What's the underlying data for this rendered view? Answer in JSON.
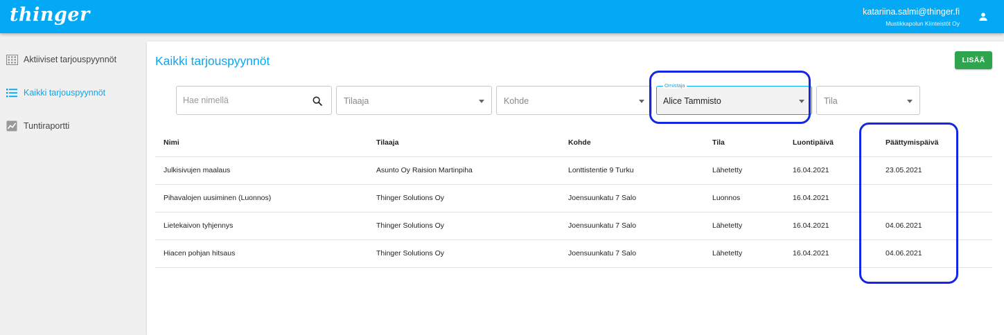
{
  "header": {
    "logo_text": "thinger",
    "user_email": "katariina.salmi@thinger.fi",
    "user_company": "Mustikkapolun Kiinteistöt Oy",
    "accent_color": "#03a9f4"
  },
  "sidebar": {
    "items": [
      {
        "label": "Aktiiviset tarjouspyynnöt",
        "icon": "building-icon",
        "active": false
      },
      {
        "label": "Kaikki tarjouspyynnöt",
        "icon": "list-icon",
        "active": true
      },
      {
        "label": "Tuntiraportti",
        "icon": "chart-icon",
        "active": false
      }
    ]
  },
  "main": {
    "title": "Kaikki tarjouspyynnöt",
    "add_button": "LISÄÄ",
    "add_button_color": "#2ea44f",
    "filters": {
      "search_placeholder": "Hae nimellä",
      "tilaaja_placeholder": "Tilaaja",
      "kohde_placeholder": "Kohde",
      "omistaja_label": "Omistaja",
      "omistaja_value": "Alice Tammisto",
      "tila_placeholder": "Tila"
    },
    "table": {
      "headers": {
        "nimi": "Nimi",
        "tilaaja": "Tilaaja",
        "kohde": "Kohde",
        "tila": "Tila",
        "luontipaiva": "Luontipäivä",
        "paattymispaiva": "Päättymispäivä"
      },
      "rows": [
        {
          "nimi": "Julkisivujen maalaus",
          "tilaaja": "Asunto Oy Raision Martinpiha",
          "kohde": "Lonttistentie 9 Turku",
          "tila": "Lähetetty",
          "luontipaiva": "16.04.2021",
          "paattymispaiva": "23.05.2021"
        },
        {
          "nimi": "Pihavalojen uusiminen (Luonnos)",
          "tilaaja": "Thinger Solutions Oy",
          "kohde": "Joensuunkatu 7 Salo",
          "tila": "Luonnos",
          "luontipaiva": "16.04.2021",
          "paattymispaiva": ""
        },
        {
          "nimi": "Lietekaivon tyhjennys",
          "tilaaja": "Thinger Solutions Oy",
          "kohde": "Joensuunkatu 7 Salo",
          "tila": "Lähetetty",
          "luontipaiva": "16.04.2021",
          "paattymispaiva": "04.06.2021"
        },
        {
          "nimi": "Hiacen pohjan hitsaus",
          "tilaaja": "Thinger Solutions Oy",
          "kohde": "Joensuunkatu 7 Salo",
          "tila": "Lähetetty",
          "luontipaiva": "16.04.2021",
          "paattymispaiva": "04.06.2021"
        }
      ]
    },
    "highlight_color": "#1526e3"
  }
}
